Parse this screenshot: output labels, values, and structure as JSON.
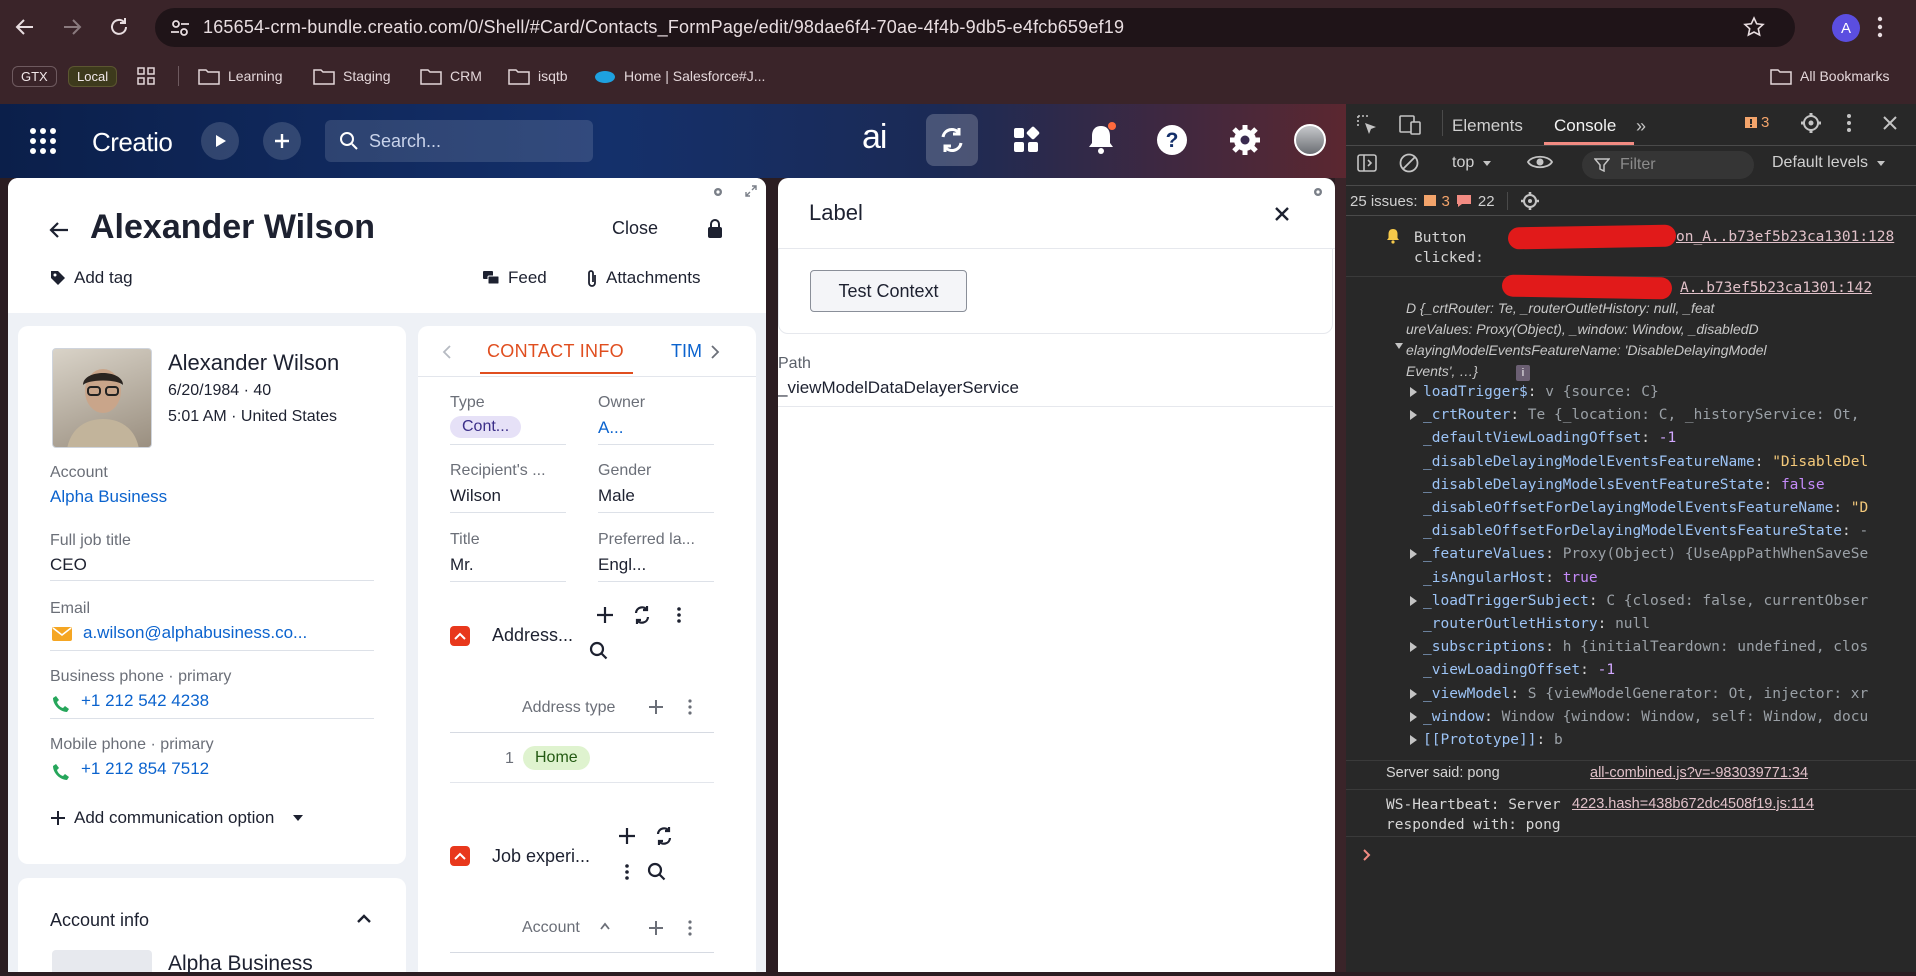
{
  "browser": {
    "url": "165654-crm-bundle.creatio.com/0/Shell/#Card/Contacts_FormPage/edit/98dae6f4-70ae-4f4b-9db5-e4fcb659ef19",
    "profile_initial": "A",
    "bookmarks": [
      "GTX",
      "Local",
      "Learning",
      "Staging",
      "CRM",
      "isqtb",
      "Home | Salesforce#J...",
      "All Bookmarks"
    ]
  },
  "app": {
    "logo": "Creatio",
    "search_placeholder": "Search...",
    "ai_label": "ai"
  },
  "record": {
    "title": "Alexander Wilson",
    "close_label": "Close",
    "add_tag": "Add tag",
    "feed": "Feed",
    "attachments": "Attachments",
    "profile": {
      "name": "Alexander Wilson",
      "dob_age": "6/20/1984 · 40",
      "time_country": "5:01 AM · United States"
    },
    "fields": {
      "account_label": "Account",
      "account_value": "Alpha Business",
      "job_title_label": "Full job title",
      "job_title_value": "CEO",
      "email_label": "Email",
      "email_value": "a.wilson@alphabusiness.co...",
      "business_phone_label": "Business phone · primary",
      "business_phone_value": "+1 212 542 4238",
      "mobile_phone_label": "Mobile phone · primary",
      "mobile_phone_value": "+1 212 854 7512",
      "add_comm": "Add communication option"
    },
    "account_info": {
      "title": "Account info",
      "company": "Alpha Business"
    },
    "tabs": [
      "CONTACT INFO",
      "TIM"
    ],
    "contact_info": {
      "type_label": "Type",
      "type_value": "Cont...",
      "owner_label": "Owner",
      "owner_value": "A...",
      "recipient_label": "Recipient's ...",
      "recipient_value": "Wilson",
      "gender_label": "Gender",
      "gender_value": "Male",
      "title_label": "Title",
      "title_value": "Mr.",
      "language_label": "Preferred la...",
      "language_value": "Engl...",
      "address_section": "Address...",
      "address_type_col": "Address type",
      "address_row_num": "1",
      "address_row_value": "Home",
      "job_section": "Job experi...",
      "job_account_col": "Account"
    }
  },
  "modal": {
    "title": "Label",
    "button": "Test Context",
    "path_label": "Path",
    "path_value": "_viewModelDataDelayerService"
  },
  "devtools": {
    "tabs": [
      "Elements",
      "Console"
    ],
    "warn_count": "3",
    "context": "top",
    "filter_placeholder": "Filter",
    "levels": "Default levels",
    "issues_text": "25 issues:",
    "issues_warn": "3",
    "issues_info": "22",
    "log1_text": "Button\nclicked:",
    "log1_src": "on_A..b73ef5b23ca1301:128",
    "log2_src": "A..b73ef5b23ca1301:142",
    "obj_head_1": "D {_crtRouter: Te, _routerOutletHistory: null, _feat",
    "obj_head_2": "ureValues: Proxy(Object), _window: Window, _disabledD",
    "obj_head_3": "elayingModelEventsFeatureName: 'DisableDelayingModel",
    "obj_head_4": "Events', …}",
    "props": [
      {
        "key": "loadTrigger$",
        "val": "v {source: C}",
        "exp": true
      },
      {
        "key": "_crtRouter",
        "val": "Te {_location: C, _historyService: Ot,",
        "exp": true
      },
      {
        "key": "_defaultViewLoadingOffset",
        "val": "-1",
        "exp": false
      },
      {
        "key": "_disableDelayingModelEventsFeatureName",
        "val": "\"DisableDel",
        "exp": false
      },
      {
        "key": "_disableDelayingModelsEventFeatureState",
        "val": "false",
        "exp": false
      },
      {
        "key": "_disableOffsetForDelayingModelEventsFeatureName",
        "val": "\"D",
        "exp": false
      },
      {
        "key": "_disableOffsetForDelayingModelEventsFeatureState",
        "val": "-",
        "exp": false
      },
      {
        "key": "_featureValues",
        "val": "Proxy(Object) {UseAppPathWhenSaveSe",
        "exp": true
      },
      {
        "key": "_isAngularHost",
        "val": "true",
        "exp": false
      },
      {
        "key": "_loadTriggerSubject",
        "val": "C {closed: false, currentObser",
        "exp": true
      },
      {
        "key": "_routerOutletHistory",
        "val": "null",
        "exp": false
      },
      {
        "key": "_subscriptions",
        "val": "h {initialTeardown: undefined, clos",
        "exp": true
      },
      {
        "key": "_viewLoadingOffset",
        "val": "-1",
        "exp": false
      },
      {
        "key": "_viewModel",
        "val": "S {viewModelGenerator: Ot, injector: xr",
        "exp": true
      },
      {
        "key": "_window",
        "val": "Window {window: Window, self: Window, docu",
        "exp": true
      },
      {
        "key": "[[Prototype]]",
        "val": "b",
        "exp": true
      }
    ],
    "server_said": "Server said: pong",
    "server_src": "all-combined.js?v=-983039771:34",
    "ws_text": "WS-Heartbeat: Server\nresponded with: pong",
    "ws_src": "4223.hash=438b672dc4508f19.js:114"
  }
}
